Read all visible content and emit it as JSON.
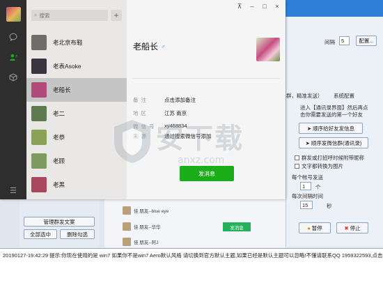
{
  "wechat": {
    "nav": {
      "menu_icon": "☰"
    },
    "search": {
      "placeholder": "搜索"
    },
    "add_icon": "+",
    "contacts": [
      {
        "name": "老北京布鞋",
        "avatar_color": "#6f6d6a"
      },
      {
        "name": "老表Asoke",
        "avatar_color": "#3a3340"
      },
      {
        "name": "老船长",
        "avatar_color": "#b04a7a"
      },
      {
        "name": "老二",
        "avatar_color": "#5c7a4d"
      },
      {
        "name": "老恭",
        "avatar_color": "#8aa256"
      },
      {
        "name": "老顾",
        "avatar_color": "#7e9a5e"
      },
      {
        "name": "老黑",
        "avatar_color": "#a8475e"
      }
    ],
    "window_controls": {
      "pin": "⊼",
      "minimize": "–",
      "maximize": "□",
      "close": "×"
    },
    "profile": {
      "name": "老船长",
      "fields": [
        {
          "key": "备注",
          "value": "点击添加备注"
        },
        {
          "key": "地区",
          "value": "江苏 南京"
        },
        {
          "key": "微信号",
          "value": "xy468834"
        },
        {
          "key": "来源",
          "value": "通过搜索微信号添加"
        }
      ],
      "send_button": "发消息"
    }
  },
  "tool": {
    "account_label": "间隔",
    "account_value": "5",
    "config_button": "配置...",
    "tabs_label": "群，精准发送）",
    "system_config": "系统配置",
    "instructions": [
      "进入【通讯录界面】然后再点",
      "击你需要发送的第一个好友"
    ],
    "btn_send_friend": "顺序给好友发信息",
    "btn_send_contacts": "顺序发微信群(通讯录)",
    "opt_mass_name": "群发或打招呼时候附带昵称",
    "opt_text_image": "文字都转换为图片",
    "each_account_label": "每个帐号发送",
    "each_account_value": "1",
    "each_account_unit": "个",
    "interval_label": "每次间隔时间",
    "interval_value": "15",
    "interval_unit": "秒",
    "pause_button": "暂停",
    "stop_button": "停止",
    "manage_button": "管理群发文案",
    "select_all_button": "全部选中",
    "clear_button": "删除勾选",
    "rows": [
      {
        "text": "佳 朋友--blue eye"
      },
      {
        "text": "佳 朋友--华华"
      },
      {
        "text": "佳 朋友--阿J"
      }
    ],
    "small_send": "发消息",
    "status_line": "20190127-19:42:29  提示:你现在使用的是 win7 如果你不是win7 Aero默认风格 请切换到官方默认主题,如果已经是默认主题可以忽略!不懂请联系QQ 1959322593,点击打开帮助!"
  },
  "watermark": {
    "text": "安下载",
    "url": "anxz.com"
  }
}
